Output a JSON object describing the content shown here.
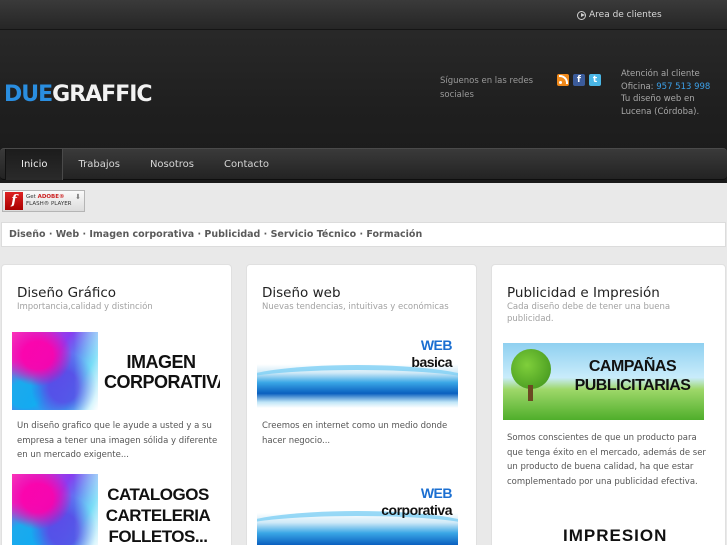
{
  "topbar": {
    "area_clientes": "Area de clientes"
  },
  "logo": {
    "part1": "DUE",
    "part2": "GRAFFIC"
  },
  "social": {
    "label": "Síguenos en las redes sociales",
    "icons": [
      "rss-icon",
      "facebook-icon",
      "twitter-icon"
    ]
  },
  "contact": {
    "line1": "Atención al cliente",
    "office_label": "Oficina:",
    "phone": "957 513 998",
    "line3": "Tu diseño web en",
    "line4": "Lucena (Córdoba)."
  },
  "nav": {
    "items": [
      "Inicio",
      "Trabajos",
      "Nosotros",
      "Contacto"
    ],
    "active": "Inicio"
  },
  "flash": {
    "line1_a": "Get ",
    "line1_b": "ADOBE®",
    "line2": "FLASH® PLAYER"
  },
  "strip": {
    "text": "Diseño · Web · Imagen corporativa · Publicidad · Servicio Técnico · Formación"
  },
  "cards": [
    {
      "title": "Diseño Gráfico",
      "subtitle": "Importancia,calidad y distinción",
      "body": "Un diseño grafico que le ayude a usted y a su empresa a tener una imagen sólida y diferente en un mercado exigente...",
      "banner1": {
        "line1": "IMAGEN",
        "line2": "CORPORATIVA"
      },
      "banner2": {
        "line1": "CATALOGOS",
        "line2": "CARTELERIA",
        "line3": "FOLLETOS..."
      }
    },
    {
      "title": "Diseño web",
      "subtitle": "Nuevas tendencias, intuitivas y económicas",
      "body": "Creemos en internet como un medio donde hacer negocio...",
      "banner1": {
        "line1": "WEB",
        "line2": "basica"
      },
      "banner2": {
        "line1": "WEB",
        "line2": "corporativa"
      }
    },
    {
      "title": "Publicidad e Impresión",
      "subtitle": "Cada diseño debe de tener una buena publicidad.",
      "body": "Somos conscientes de que un producto para que tenga éxito en el mercado, además de ser un producto de buena calidad, ha que estar complementado por una publicidad efectiva.",
      "banner1": {
        "line1": "CAMPAÑAS",
        "line2": "PUBLICITARIAS"
      },
      "banner2": {
        "line1": "IMPRESION"
      }
    }
  ],
  "colors": {
    "accent_blue": "#2a8ee0",
    "phone_blue": "#3c9fe6",
    "header_dark": "#222222"
  }
}
